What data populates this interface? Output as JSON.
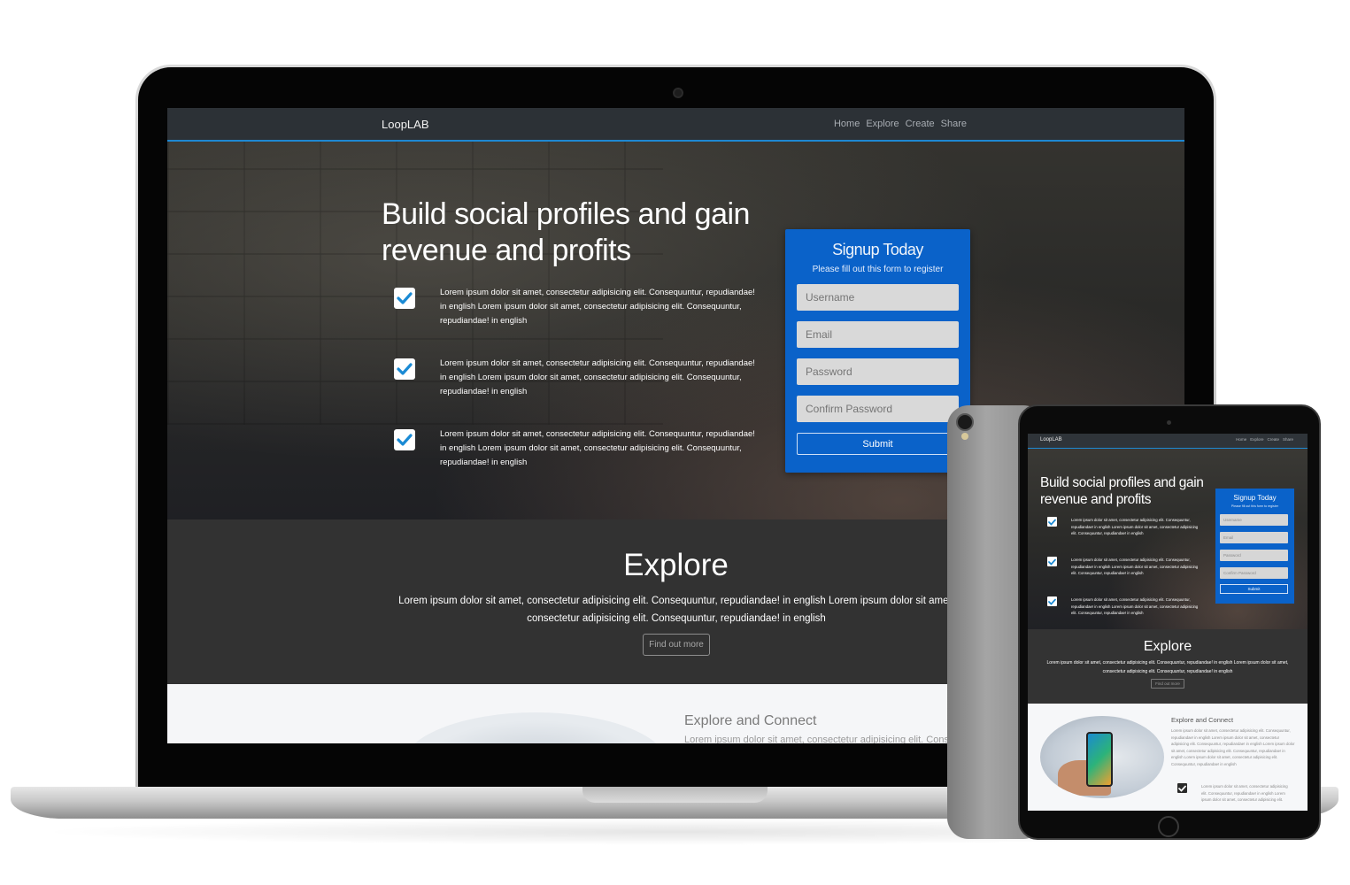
{
  "site": {
    "brand": "LoopLAB",
    "nav": [
      "Home",
      "Explore",
      "Create",
      "Share"
    ]
  },
  "hero": {
    "title_parts": [
      "Build ",
      "social profiles",
      " and gain revenue and ",
      "profits"
    ],
    "features": [
      "Lorem ipsum dolor sit amet, consectetur adipisicing elit. Consequuntur, repudiandae! in english Lorem ipsum dolor sit amet, consectetur adipisicing elit. Consequuntur, repudiandae! in english",
      "Lorem ipsum dolor sit amet, consectetur adipisicing elit. Consequuntur, repudiandae! in english Lorem ipsum dolor sit amet, consectetur adipisicing elit. Consequuntur, repudiandae! in english",
      "Lorem ipsum dolor sit amet, consectetur adipisicing elit. Consequuntur, repudiandae! in english Lorem ipsum dolor sit amet, consectetur adipisicing elit. Consequuntur, repudiandae! in english"
    ]
  },
  "signup": {
    "title": "Signup Today",
    "subtitle": "Please fill out this form to register",
    "fields": {
      "username": "Username",
      "email": "Email",
      "password": "Password",
      "confirm": "Confirm Password"
    },
    "submit": "Submit"
  },
  "explore": {
    "title": "Explore",
    "text": "Lorem ipsum dolor sit amet, consectetur adipisicing elit. Consequuntur, repudiandae! in english Lorem ipsum dolor sit amet, consectetur adipisicing elit. Consequuntur, repudiandae! in english",
    "button": "Find out more"
  },
  "connect": {
    "title": "Explore and Connect",
    "text": "Lorem ipsum dolor sit amet, consectetur adipisicing elit. Consequuntur,",
    "tablet_text": "Lorem ipsum dolor sit amet, consectetur adipisicing elit. Consequuntur, repudiandae! in english Lorem ipsum dolor sit amet, consectetur adipisicing elit. Consequuntur, repudiandae! in english Lorem ipsum dolor sit amet, consectetur adipisicing elit. Consequuntur, repudiandae! in english Lorem ipsum dolor sit amet, consectetur adipisicing elit. Consequuntur, repudiandae! in english",
    "tablet_feature": "Lorem ipsum dolor sit amet, consectetur adipisicing elit. Consequuntur, repudiandae! in english Lorem ipsum dolor sit amet, consectetur adipisicing elit."
  },
  "colors": {
    "accent_blue": "#0a62c9",
    "nav_underline": "#1e88d2",
    "check_blue": "#1a8ad4",
    "dark_section": "#323232"
  },
  "icons": [
    "camera-icon",
    "checkbox-checked-icon"
  ]
}
